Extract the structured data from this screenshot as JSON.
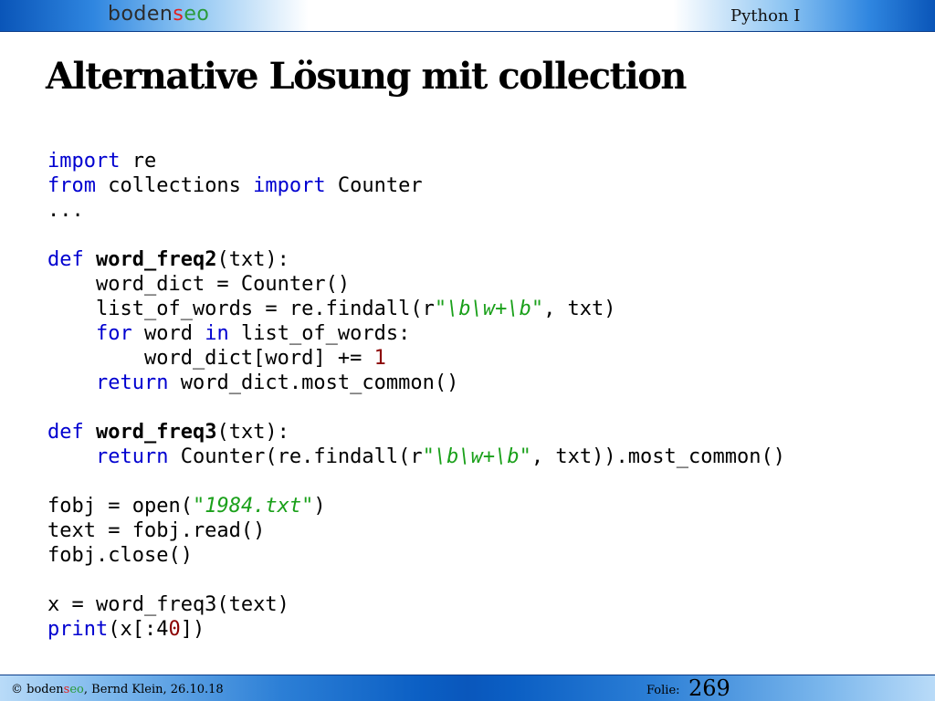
{
  "header": {
    "logo_part1": "boden",
    "logo_part2": "s",
    "logo_part3": "eo",
    "course": "Python I"
  },
  "slide": {
    "title": "Alternative Lösung mit collection"
  },
  "code": {
    "l1_kw": "import",
    "l1_rest": " re",
    "l2_kw1": "from",
    "l2_mid": " collections ",
    "l2_kw2": "import",
    "l2_rest": " Counter",
    "l3": "...",
    "l5_kw": "def",
    "l5_fn": "word_freq2",
    "l5_rest": "(txt):",
    "l6": "    word_dict = Counter()",
    "l7_a": "    list_of_words = re.findall(r",
    "l7_q1": "\"",
    "l7_s": "\\b\\w+\\b",
    "l7_q2": "\"",
    "l7_b": ", txt)",
    "l8_indent": "    ",
    "l8_kw1": "for",
    "l8_mid": " word ",
    "l8_kw2": "in",
    "l8_rest": " list_of_words:",
    "l9_a": "        word_dict[word] += ",
    "l9_num": "1",
    "l10_indent": "    ",
    "l10_kw": "return",
    "l10_rest": " word_dict.most_common()",
    "l12_kw": "def",
    "l12_fn": "word_freq3",
    "l12_rest": "(txt):",
    "l13_indent": "    ",
    "l13_kw": "return",
    "l13_a": " Counter(re.findall(r",
    "l13_q1": "\"",
    "l13_s": "\\b\\w+\\b",
    "l13_q2": "\"",
    "l13_b": ", txt)).most_common()",
    "l15_a": "fobj = open(",
    "l15_q1": "\"",
    "l15_s": "1984.txt",
    "l15_q2": "\"",
    "l15_b": ")",
    "l16": "text = fobj.read()",
    "l17": "fobj.close()",
    "l19": "x = word_freq3(text)",
    "l20_kw": "print",
    "l20_a": "(x[:4",
    "l20_num": "0",
    "l20_b": "])"
  },
  "footer": {
    "copyright_a": "© boden",
    "copyright_b": "s",
    "copyright_c": "eo",
    "copyright_d": ", Bernd Klein, 26.10.18",
    "folie_label": "Folie:",
    "folie_number": "269"
  },
  "colors": {
    "keyword": "#0000d0",
    "string": "#1aa01a",
    "number": "#8b0000",
    "header_blue": "#0a55b8"
  }
}
